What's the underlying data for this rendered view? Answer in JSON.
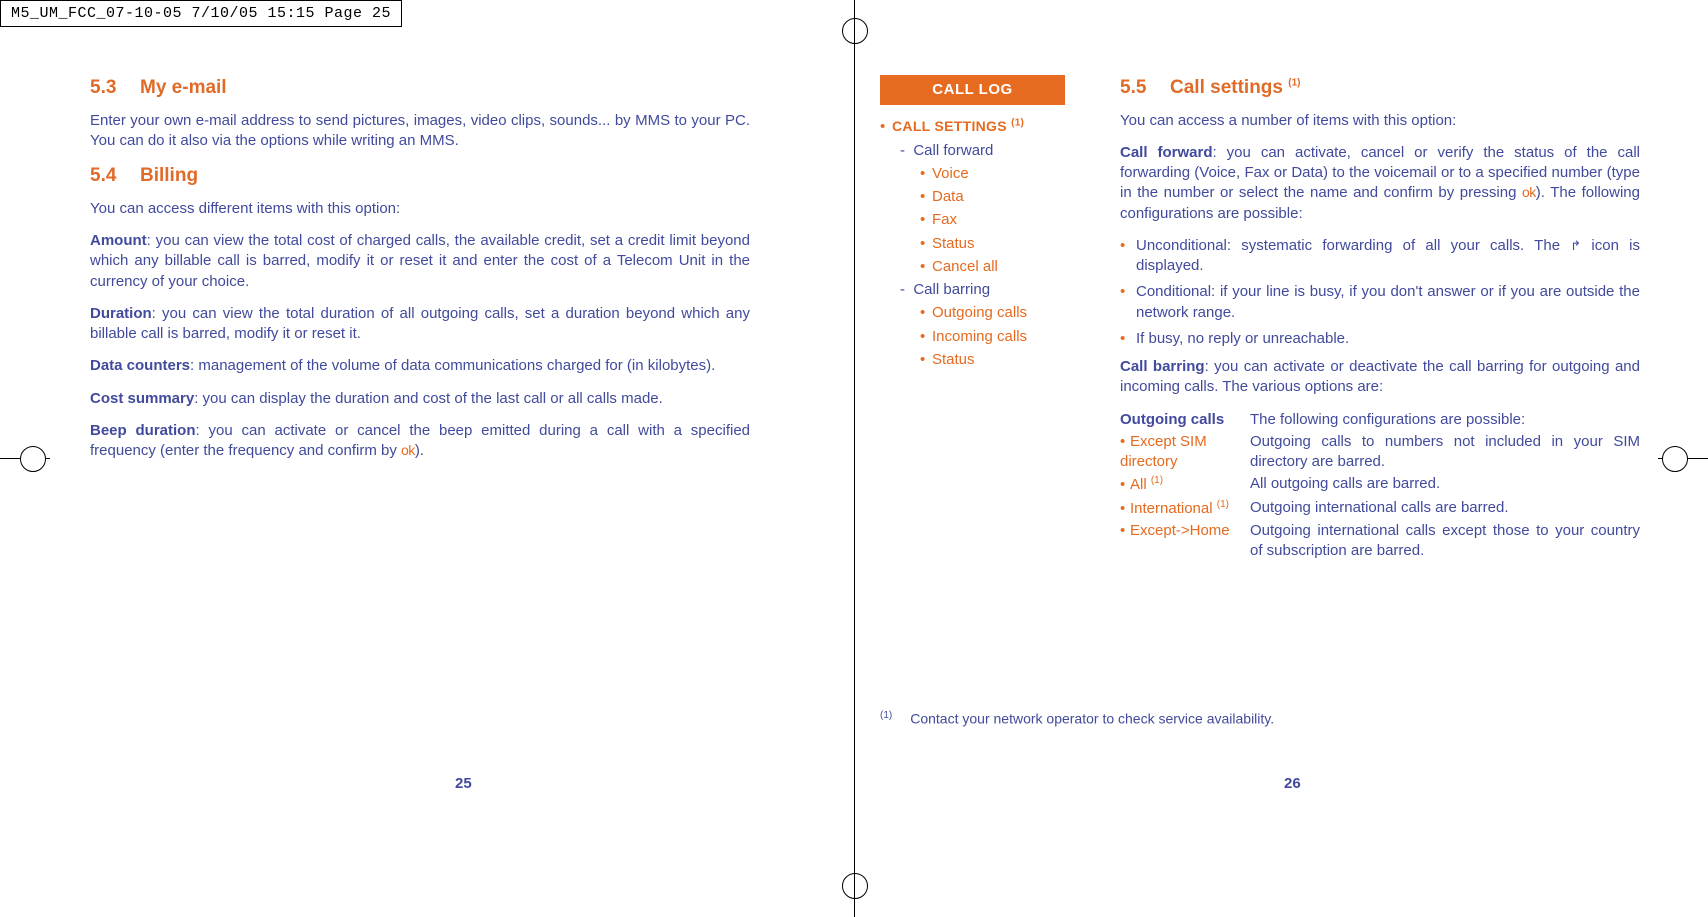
{
  "crop_label": "M5_UM_FCC_07-10-05  7/10/05  15:15  Page 25",
  "left": {
    "s53_num": "5.3",
    "s53_title": "My e-mail",
    "s53_body": "Enter your own e-mail address to send pictures, images, video clips, sounds... by MMS to your PC. You can do it also via the options while writing an MMS.",
    "s54_num": "5.4",
    "s54_title": "Billing",
    "s54_intro": "You can access different items with this option:",
    "amount_lbl": "Amount",
    "amount_txt": ": you can view the total cost of charged calls, the available credit, set a credit limit beyond which any billable call is barred, modify it or reset it and enter the cost of a Telecom Unit in the currency of your choice.",
    "duration_lbl": "Duration",
    "duration_txt": ": you can view the total duration of all outgoing calls, set a duration beyond which any billable call is barred, modify it or reset it.",
    "datac_lbl": "Data counters",
    "datac_txt": ": management of the volume of data communications charged for (in kilobytes).",
    "cost_lbl": "Cost summary",
    "cost_txt": ": you can display the duration and cost of the last call or all calls made.",
    "beep_lbl": "Beep duration",
    "beep_txt_a": ": you can activate or cancel the beep emitted during a call with a specified frequency (enter the frequency and confirm by ",
    "beep_txt_b": ").",
    "pagenum": "25"
  },
  "right": {
    "tag": "CALL LOG",
    "menu_main": "CALL SETTINGS ",
    "menu_main_sup": "(1)",
    "mf": "Call forward",
    "mf_voice": "Voice",
    "mf_data": "Data",
    "mf_fax": "Fax",
    "mf_status": "Status",
    "mf_cancel": "Cancel all",
    "mb": "Call barring",
    "mb_out": "Outgoing calls",
    "mb_in": "Incoming calls",
    "mb_status": "Status",
    "s55_num": "5.5",
    "s55_title": "Call settings ",
    "s55_sup": "(1)",
    "s55_intro": "You can access a number of items with this option:",
    "cf_lbl": "Call forward",
    "cf_txt_a": ": you can activate, cancel or verify the status of the call forwarding (Voice, Fax or Data) to the voicemail or to a specified number (type in the number or select the name and confirm by pressing ",
    "cf_txt_b": "). The following configurations are possible:",
    "cf_b1_a": "Unconditional: systematic forwarding of all your calls. The ",
    "cf_b1_b": " icon is displayed.",
    "cf_b2": "Conditional: if your line is busy, if you don't answer or if you are outside the network range.",
    "cf_b3": "If busy, no reply or unreachable.",
    "cb_lbl": "Call barring",
    "cb_txt": ": you can activate or deactivate the call barring for outgoing and incoming calls. The various options are:",
    "out_lbl": "Outgoing calls",
    "out_txt": "The following configurations are possible:",
    "r1_lbl": "Except SIM directory",
    "r1_txt": "Outgoing calls to numbers not included in your SIM directory are barred.",
    "r2_lbl": "All ",
    "r2_sup": "(1)",
    "r2_txt": "All outgoing calls are barred.",
    "r3_lbl": "International ",
    "r3_sup": "(1)",
    "r3_txt": "Outgoing international calls are barred.",
    "r4_lbl": "Except->Home",
    "r4_txt": "Outgoing international calls except those to your country of subscription are barred.",
    "footnote_sup": "(1)",
    "footnote_txt": "Contact your network operator to check service availability.",
    "pagenum": "26"
  },
  "ok_text": "ok"
}
